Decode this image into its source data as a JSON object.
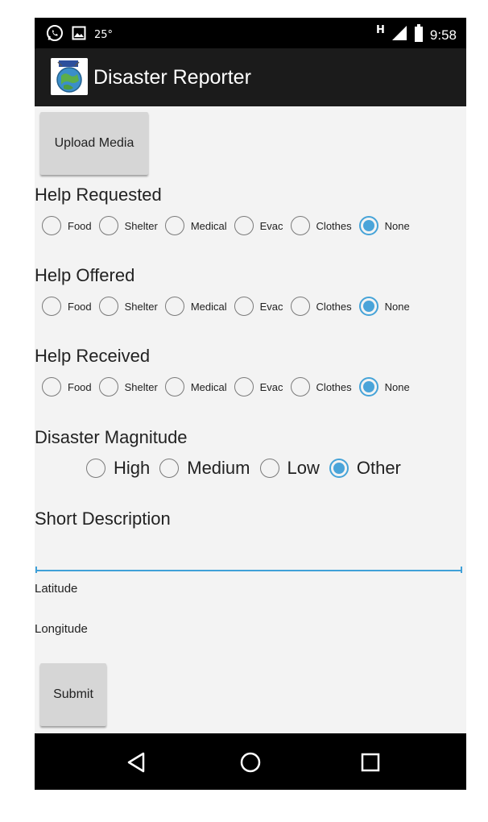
{
  "status_bar": {
    "notification_icons": [
      "whatsapp-icon",
      "image-icon"
    ],
    "temperature": "25°",
    "network_type": "H",
    "time": "9:58"
  },
  "app_bar": {
    "title": "Disaster Reporter",
    "logo_icon": "globe-logo-icon"
  },
  "upload_button": {
    "label": "Upload Media"
  },
  "help_requested": {
    "label": "Help Requested",
    "options": [
      {
        "label": "Food",
        "checked": false
      },
      {
        "label": "Shelter",
        "checked": false
      },
      {
        "label": "Medical",
        "checked": false
      },
      {
        "label": "Evac",
        "checked": false
      },
      {
        "label": "Clothes",
        "checked": false
      },
      {
        "label": "None",
        "checked": true
      }
    ]
  },
  "help_offered": {
    "label": "Help Offered",
    "options": [
      {
        "label": "Food",
        "checked": false
      },
      {
        "label": "Shelter",
        "checked": false
      },
      {
        "label": "Medical",
        "checked": false
      },
      {
        "label": "Evac",
        "checked": false
      },
      {
        "label": "Clothes",
        "checked": false
      },
      {
        "label": "None",
        "checked": true
      }
    ]
  },
  "help_received": {
    "label": "Help Received",
    "options": [
      {
        "label": "Food",
        "checked": false
      },
      {
        "label": "Shelter",
        "checked": false
      },
      {
        "label": "Medical",
        "checked": false
      },
      {
        "label": "Evac",
        "checked": false
      },
      {
        "label": "Clothes",
        "checked": false
      },
      {
        "label": "None",
        "checked": true
      }
    ]
  },
  "magnitude": {
    "label": "Disaster Magnitude",
    "options": [
      {
        "label": "High",
        "checked": false
      },
      {
        "label": "Medium",
        "checked": false
      },
      {
        "label": "Low",
        "checked": false
      },
      {
        "label": "Other",
        "checked": true
      }
    ]
  },
  "description": {
    "label": "Short Description",
    "value": ""
  },
  "latitude": {
    "label": "Latitude"
  },
  "longitude": {
    "label": "Longitude"
  },
  "submit_button": {
    "label": "Submit"
  },
  "nav_bar": {
    "back_icon": "back-triangle-icon",
    "home_icon": "home-circle-icon",
    "recents_icon": "recents-square-icon"
  },
  "colors": {
    "accent": "#4aa4d9",
    "app_bar": "#1b1b1b",
    "background": "#f3f3f3",
    "button": "#d6d6d6"
  }
}
